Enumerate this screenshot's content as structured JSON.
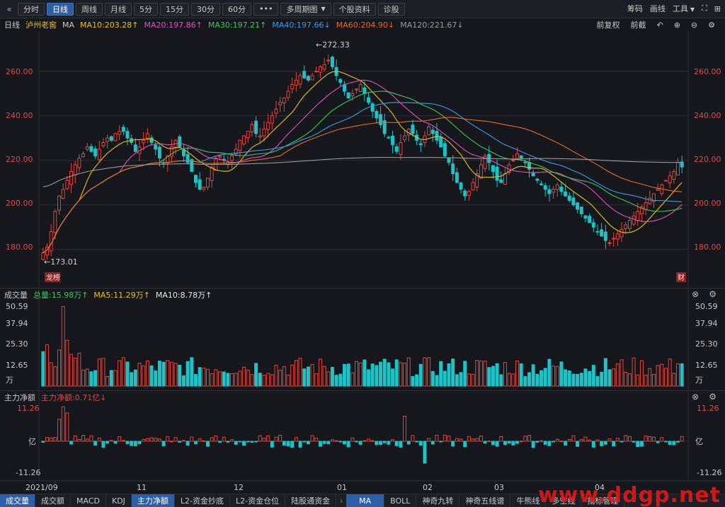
{
  "toolbar": {
    "left_items": [
      "分时",
      "日线",
      "周线",
      "月线",
      "5分",
      "15分",
      "30分",
      "60分"
    ],
    "more_label": "•••",
    "multi_period": "多周期图",
    "stock_info": "个股资料",
    "diagnose": "诊股",
    "right_items": [
      "筹码",
      "画线",
      "工具"
    ],
    "colors": {
      "active": "#2d5fa8"
    }
  },
  "legend": {
    "period": "日线",
    "stock_name": "泸州老窖",
    "ma_label": "MA",
    "ma_items": [
      {
        "text": "MA10:203.28↑",
        "color": "#e8c21c"
      },
      {
        "text": "MA20:197.86↑",
        "color": "#e64fbd"
      },
      {
        "text": "MA30:197.21↑",
        "color": "#3cc85a"
      },
      {
        "text": "MA40:197.66↓",
        "color": "#3c9be6"
      },
      {
        "text": "MA60:204.90↓",
        "color": "#e8692a"
      },
      {
        "text": "MA120:221.67↓",
        "color": "#999999"
      }
    ],
    "adjust": "前复权",
    "cut": "前截"
  },
  "price_axis": {
    "ticks": [
      "260.00",
      "240.00",
      "220.00",
      "200.00",
      "180.00"
    ],
    "high_label": "←272.33",
    "low_label": "←173.01",
    "marker_left": "龙榜",
    "marker_right": "财"
  },
  "volume_panel": {
    "title": "成交量",
    "total": "总量:15.98万↑",
    "ma5": "MA5:11.29万↑",
    "ma10": "MA10:8.78万↑",
    "ticks": [
      "50.59",
      "37.94",
      "25.30",
      "12.65"
    ],
    "unit": "万"
  },
  "flow_panel": {
    "title": "主力净额",
    "value": "主力净额:0.71亿↓",
    "ticks": [
      "11.26",
      "-11.26"
    ],
    "unit": "亿"
  },
  "time_axis": [
    "2021/09",
    "11",
    "12",
    "01",
    "02",
    "03",
    "04"
  ],
  "tabs": [
    "成交量",
    "成交额",
    "MACD",
    "KDJ",
    "主力净额",
    "L2-资金抄底",
    "L2-资金仓位",
    "陆股通资金",
    "MA",
    "BOLL",
    "神奇九转",
    "神奇五线谱",
    "牛熊线",
    "多空线",
    "指标管理"
  ],
  "watermark": "www.ddgp.net",
  "chart_data": {
    "type": "line",
    "title": "泸州老窖 日线",
    "ylim": [
      165,
      278
    ],
    "close": [
      178.5,
      181,
      188,
      197,
      204,
      207,
      211,
      215,
      218,
      221,
      223,
      226,
      224,
      222,
      225,
      228,
      230,
      229,
      232,
      233,
      233,
      230,
      228,
      224,
      226,
      229,
      232,
      228,
      225,
      221,
      219,
      222,
      226,
      229,
      226,
      222,
      219,
      215,
      210,
      207,
      208,
      212,
      217,
      221,
      222,
      220,
      219,
      222,
      225,
      229,
      231,
      233,
      236,
      232,
      231,
      234,
      237,
      240,
      243,
      246,
      248,
      251,
      254,
      256,
      258,
      257,
      256,
      258,
      260,
      262,
      263,
      265,
      262,
      258,
      255,
      251,
      248,
      250,
      252,
      254,
      250,
      246,
      242,
      239,
      236,
      232,
      230,
      227,
      224,
      228,
      231,
      234,
      232,
      229,
      227,
      231,
      235,
      232,
      229,
      226,
      222,
      219,
      214,
      210,
      207,
      204,
      206,
      210,
      214,
      218,
      222,
      219,
      215,
      211,
      210,
      214,
      218,
      220,
      223,
      221,
      219,
      216,
      213,
      211,
      209,
      207,
      205,
      207,
      209,
      206,
      204,
      202,
      200,
      198,
      196,
      194,
      192,
      190,
      188,
      186,
      184,
      183,
      185,
      187,
      189,
      191,
      193,
      195,
      197,
      199,
      201,
      203,
      205,
      207,
      209,
      211,
      213,
      215,
      219,
      217
    ]
  }
}
